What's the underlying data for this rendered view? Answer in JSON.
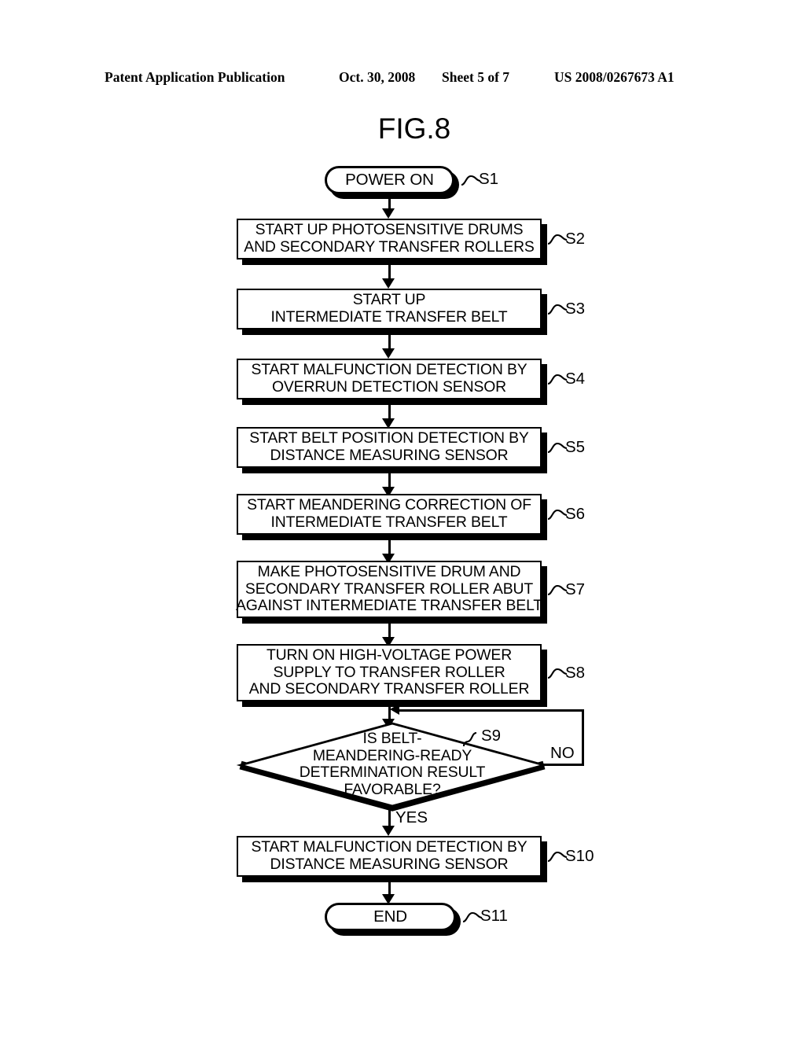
{
  "header": {
    "publication": "Patent Application Publication",
    "date": "Oct. 30, 2008",
    "sheet": "Sheet 5 of 7",
    "patent_number": "US 2008/0267673 A1"
  },
  "figure": {
    "title": "FIG.8"
  },
  "flowchart": {
    "nodes": [
      {
        "tag": "S1",
        "shape": "terminator",
        "lines": [
          "POWER ON"
        ]
      },
      {
        "tag": "S2",
        "shape": "process",
        "lines": [
          "START UP PHOTOSENSITIVE DRUMS",
          "AND SECONDARY TRANSFER ROLLERS"
        ]
      },
      {
        "tag": "S3",
        "shape": "process",
        "lines": [
          "START UP",
          "INTERMEDIATE TRANSFER BELT"
        ]
      },
      {
        "tag": "S4",
        "shape": "process",
        "lines": [
          "START MALFUNCTION DETECTION BY",
          "OVERRUN DETECTION SENSOR"
        ]
      },
      {
        "tag": "S5",
        "shape": "process",
        "lines": [
          "START BELT POSITION DETECTION BY",
          "DISTANCE MEASURING SENSOR"
        ]
      },
      {
        "tag": "S6",
        "shape": "process",
        "lines": [
          "START MEANDERING CORRECTION OF",
          "INTERMEDIATE TRANSFER BELT"
        ]
      },
      {
        "tag": "S7",
        "shape": "process",
        "lines": [
          "MAKE PHOTOSENSITIVE DRUM AND",
          "SECONDARY TRANSFER ROLLER ABUT",
          "AGAINST INTERMEDIATE TRANSFER BELT"
        ]
      },
      {
        "tag": "S8",
        "shape": "process",
        "lines": [
          "TURN ON HIGH-VOLTAGE POWER",
          "SUPPLY TO TRANSFER ROLLER",
          "AND SECONDARY TRANSFER ROLLER"
        ]
      },
      {
        "tag": "S9",
        "shape": "decision",
        "lines": [
          "IS BELT-",
          "MEANDERING-READY",
          "DETERMINATION RESULT",
          "FAVORABLE?"
        ]
      },
      {
        "tag": "S10",
        "shape": "process",
        "lines": [
          "START MALFUNCTION DETECTION BY",
          "DISTANCE MEASURING SENSOR"
        ]
      },
      {
        "tag": "S11",
        "shape": "terminator",
        "lines": [
          "END"
        ]
      }
    ],
    "branches": {
      "yes_label": "YES",
      "no_label": "NO"
    }
  },
  "colors": {
    "ink": "#000000",
    "paper": "#ffffff"
  }
}
